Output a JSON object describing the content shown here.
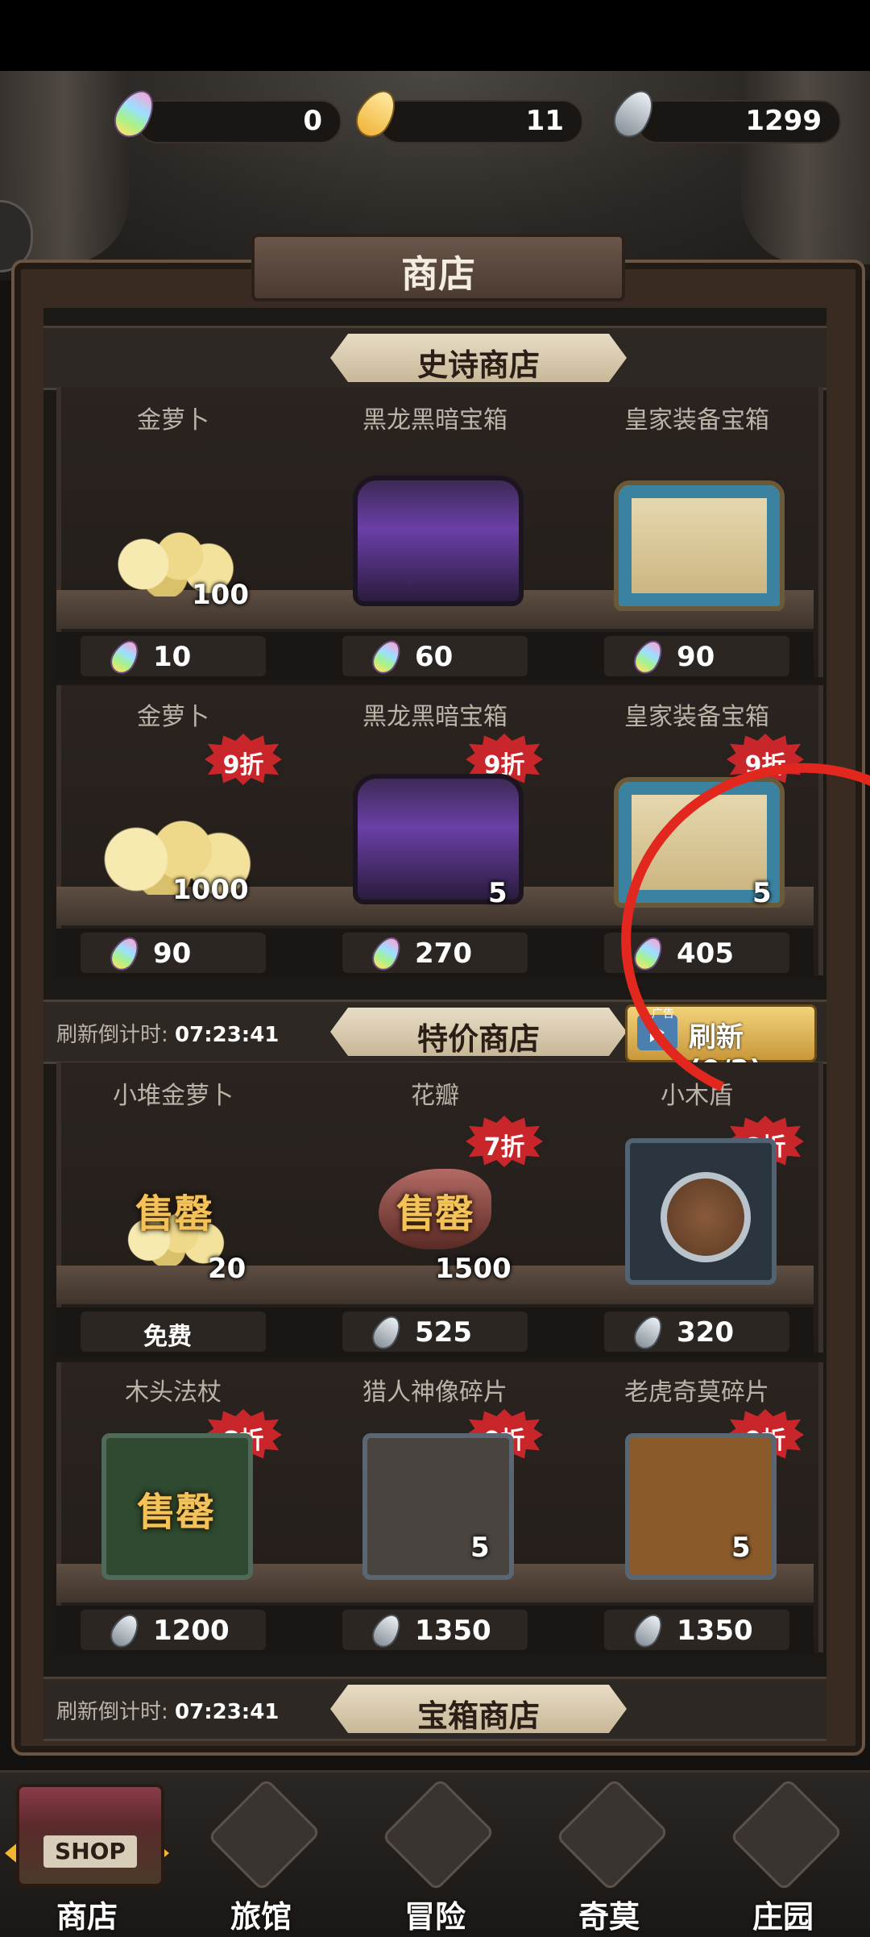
{
  "currencies": [
    {
      "name": "rainbow-carrot",
      "value": "0"
    },
    {
      "name": "gold-carrot",
      "value": "11"
    },
    {
      "name": "silver-carrot",
      "value": "1299"
    }
  ],
  "title": "商店",
  "sections": {
    "epic": {
      "title": "史诗商店"
    },
    "special": {
      "title": "特价商店",
      "countdown_label": "刷新倒计时:",
      "countdown_value": "07:23:41",
      "refresh_label": "刷新(0/2)",
      "ad_tag": "广告"
    },
    "chest": {
      "title": "宝箱商店",
      "countdown_label": "刷新倒计时:",
      "countdown_value": "07:23:41"
    }
  },
  "epic_rows": [
    {
      "items": [
        {
          "name": "金萝卜",
          "count": "100",
          "price": "10",
          "discount": ""
        },
        {
          "name": "黑龙黑暗宝箱",
          "count": "",
          "price": "60",
          "discount": ""
        },
        {
          "name": "皇家装备宝箱",
          "count": "",
          "price": "90",
          "discount": ""
        }
      ]
    },
    {
      "items": [
        {
          "name": "金萝卜",
          "count": "1000",
          "price": "90",
          "discount": "9折"
        },
        {
          "name": "黑龙黑暗宝箱",
          "count": "5",
          "price": "270",
          "discount": "9折"
        },
        {
          "name": "皇家装备宝箱",
          "count": "5",
          "price": "405",
          "discount": "9折"
        }
      ]
    }
  ],
  "special_rows": [
    {
      "items": [
        {
          "name": "小堆金萝卜",
          "count": "20",
          "price": "免费",
          "discount": "",
          "sold": "售罄"
        },
        {
          "name": "花瓣",
          "count": "1500",
          "price": "525",
          "discount": "7折",
          "sold": "售罄"
        },
        {
          "name": "小木盾",
          "count": "",
          "price": "320",
          "discount": "8折",
          "sold": ""
        }
      ]
    },
    {
      "items": [
        {
          "name": "木头法杖",
          "count": "",
          "price": "1200",
          "discount": "8折",
          "sold": "售罄"
        },
        {
          "name": "猎人神像碎片",
          "count": "5",
          "price": "1350",
          "discount": "9折",
          "sold": ""
        },
        {
          "name": "老虎奇莫碎片",
          "count": "5",
          "price": "1350",
          "discount": "9折",
          "sold": ""
        }
      ]
    }
  ],
  "nav": [
    {
      "label": "商店",
      "art": "shop-icon",
      "sign": "SHOP"
    },
    {
      "label": "旅馆",
      "art": "inn-gate-icon"
    },
    {
      "label": "冒险",
      "art": "crossed-swords-icon"
    },
    {
      "label": "奇莫",
      "art": "chimo-character-icon"
    },
    {
      "label": "庄园",
      "art": "manor-island-icon"
    }
  ],
  "colors": {
    "discount": "#c8262a",
    "sold": "#f3c35a",
    "annotation": "#e2271e"
  }
}
